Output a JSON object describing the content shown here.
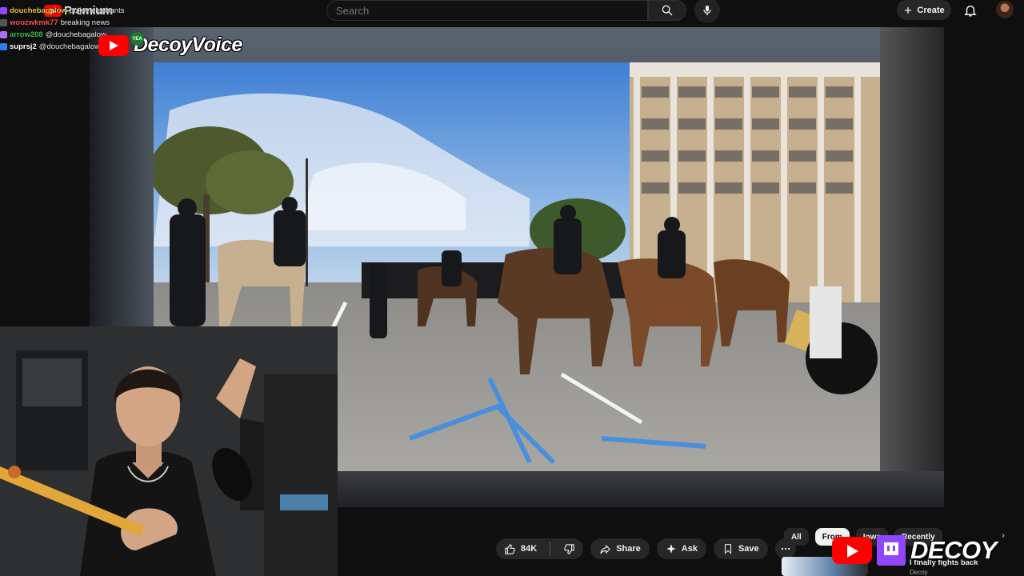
{
  "header": {
    "logo_text": "Premium",
    "search_placeholder": "Search",
    "create_label": "Create"
  },
  "chat": [
    {
      "user": "douchebagalow",
      "message": "police elephants",
      "color": "#e8c33a",
      "badge": "#9146ff"
    },
    {
      "user": "woozwkmk77",
      "message": "breaking news",
      "color": "#ff4f4f",
      "badge": "#555555"
    },
    {
      "user": "arrow208",
      "message": "@douchebagalow",
      "color": "#3fb950",
      "badge": "#a970ff"
    },
    {
      "user": "suprsj2",
      "message": "@douchebagalow that",
      "color": "#ffffff",
      "badge": "#2f80ed"
    }
  ],
  "overlay_top": {
    "brand": "DecoyVoice",
    "badge": "YEA"
  },
  "actions": {
    "like_count": "84K",
    "share_label": "Share",
    "ask_label": "Ask",
    "save_label": "Save"
  },
  "chips": {
    "all": "All",
    "from": "From",
    "related": "Iowa",
    "recent": "Recently"
  },
  "recommendation": {
    "title": "I finally fights back",
    "meta": "Decoy"
  },
  "overlay_bottom": {
    "brand": "DECOY"
  }
}
